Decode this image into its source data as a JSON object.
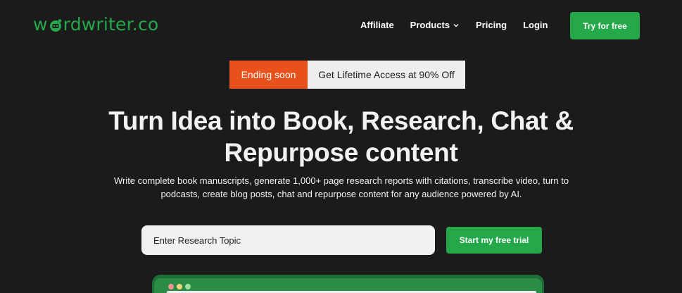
{
  "brand": {
    "logo_prefix": "w",
    "logo_suffix": "rdwriter.co",
    "accent_color": "#25a84a"
  },
  "nav": {
    "items": [
      {
        "label": "Affiliate"
      },
      {
        "label": "Products",
        "icon": "chevron-down-icon"
      },
      {
        "label": "Pricing"
      },
      {
        "label": "Login"
      }
    ],
    "cta_label": "Try for free"
  },
  "promo": {
    "tag": "Ending soon",
    "text": "Get Lifetime Access at 90% Off",
    "tag_color": "#e8501c"
  },
  "hero": {
    "title_line1": "Turn Idea into Book, Research, Chat &",
    "title_line2": "Repurpose content",
    "subtitle_line1": "Write complete book manuscripts, generate 1,000+ page research reports with citations, transcribe video, turn to",
    "subtitle_line2": "podcasts, create blog posts, chat and repurpose content for any audience powered by AI."
  },
  "search": {
    "placeholder": "Enter Research Topic",
    "button_label": "Start my free trial"
  }
}
